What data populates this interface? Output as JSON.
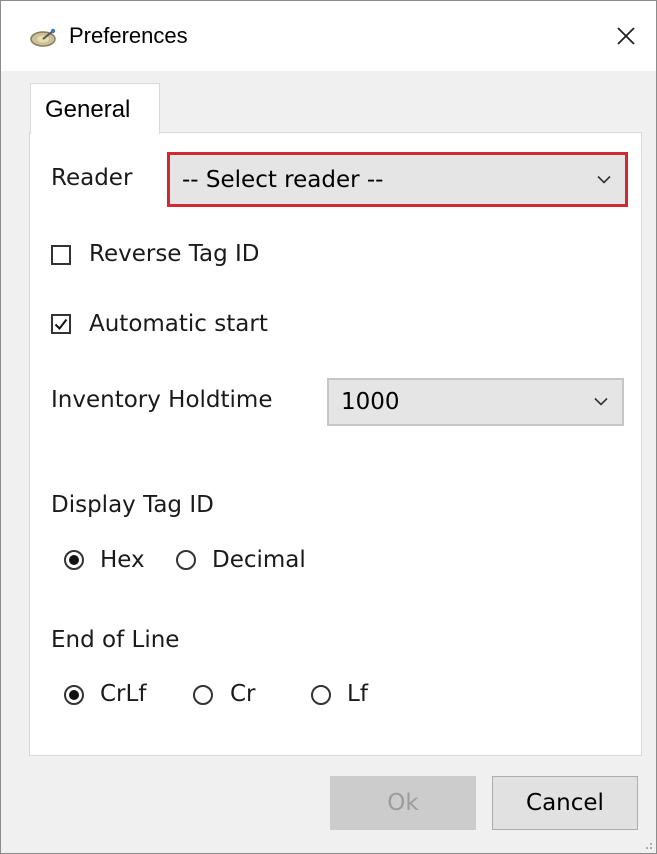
{
  "window": {
    "title": "Preferences",
    "app_icon": "satellite-dish-icon",
    "close_icon": "close-icon"
  },
  "tabs": [
    {
      "label": "General",
      "selected": true
    }
  ],
  "general": {
    "reader_label": "Reader",
    "reader_value": "-- Select reader --",
    "reverse_tag_label": "Reverse Tag ID",
    "reverse_tag_checked": false,
    "auto_start_label": "Automatic start",
    "auto_start_checked": true,
    "holdtime_label": "Inventory Holdtime",
    "holdtime_value": "1000",
    "display_tag_label": "Display Tag ID",
    "display_tag_options": [
      {
        "label": "Hex",
        "selected": true
      },
      {
        "label": "Decimal",
        "selected": false
      }
    ],
    "eol_label": "End of Line",
    "eol_options": [
      {
        "label": "CrLf",
        "selected": true
      },
      {
        "label": "Cr",
        "selected": false
      },
      {
        "label": "Lf",
        "selected": false
      }
    ]
  },
  "footer": {
    "ok_label": "Ok",
    "ok_enabled": false,
    "cancel_label": "Cancel"
  },
  "colors": {
    "focus_border": "#d0292f",
    "panel": "#ffffff",
    "window_bg": "#f0f0f0"
  }
}
